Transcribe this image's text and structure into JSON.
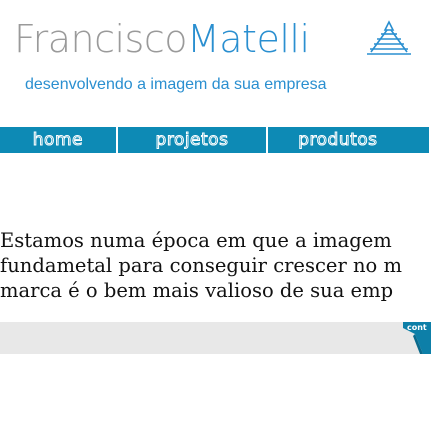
{
  "header": {
    "logo_first": "Francisco",
    "logo_second": "Matelli",
    "slogan": "desenvolvendo a imagem da sua empresa"
  },
  "nav": {
    "items": [
      {
        "label": "home"
      },
      {
        "label": "projetos"
      },
      {
        "label": "produtos"
      }
    ]
  },
  "main": {
    "intro_lines": [
      "Estamos numa época em que a imagem",
      "fundametal para conseguir crescer no m",
      "marca é o bem mais valioso de sua emp"
    ],
    "tab_label": "cont"
  },
  "colors": {
    "brand_blue": "#2a8fd0",
    "nav_blue": "#0d8ab5",
    "logo_gray": "#9a9a9a",
    "bar_gray": "#e8e8e8"
  }
}
